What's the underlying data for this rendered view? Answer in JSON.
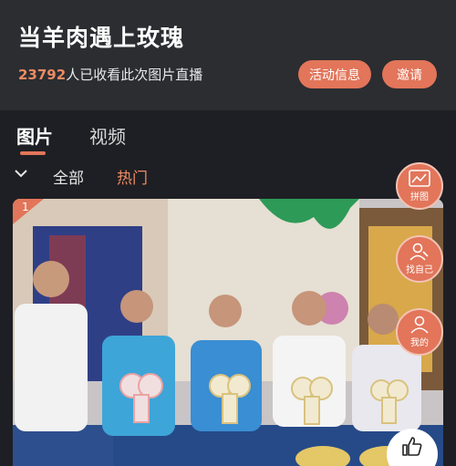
{
  "header": {
    "title": "当羊肉遇上玫瑰",
    "viewer_count": "23792",
    "viewer_suffix": "人已收看此次图片直播",
    "activity_button": "活动信息",
    "invite_button": "邀请"
  },
  "tabs": [
    {
      "label": "图片",
      "active": true
    },
    {
      "label": "视频",
      "active": false
    }
  ],
  "filters": {
    "items": [
      "全部",
      "热门"
    ],
    "selected": "热门"
  },
  "photo": {
    "index_badge": "1"
  },
  "floating_buttons": {
    "pintu": "拼图",
    "find_me": "找自己",
    "mine": "我的"
  },
  "colors": {
    "accent": "#e2755a",
    "accent_text": "#ee8a62",
    "header_bg": "#2b2d31",
    "page_bg": "#1e1f24"
  }
}
